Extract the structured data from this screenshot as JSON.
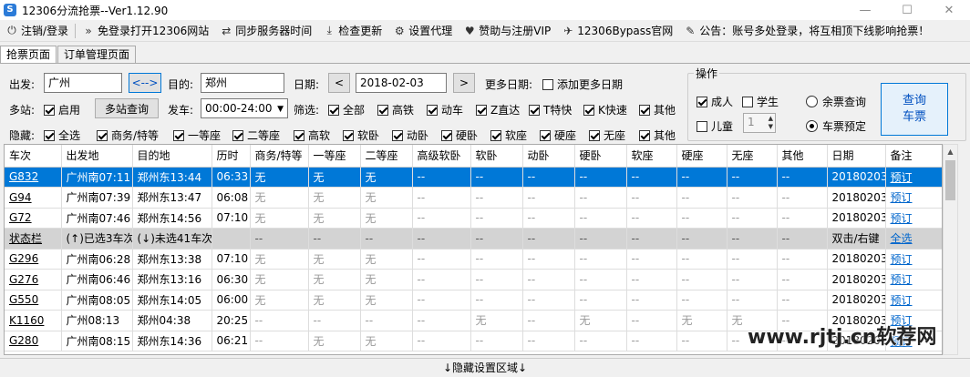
{
  "window": {
    "title": "12306分流抢票--Ver1.12.90",
    "icon": "S"
  },
  "menu": [
    {
      "icon": "⏻",
      "label": "注销/登录"
    },
    {
      "icon": "»",
      "label": "免登录打开12306网站"
    },
    {
      "icon": "⇄",
      "label": "同步服务器时间"
    },
    {
      "icon": "⤓",
      "label": "检查更新"
    },
    {
      "icon": "⚙",
      "label": "设置代理"
    },
    {
      "icon": "♥",
      "label": "赞助与注册VIP"
    },
    {
      "icon": "✈",
      "label": "12306Bypass官网"
    },
    {
      "icon": "✎",
      "label": "公告：账号多处登录，将互相顶下线影响抢票！"
    }
  ],
  "tabs": [
    "抢票页面",
    "订单管理页面"
  ],
  "form": {
    "from_label": "出发:",
    "from_value": "广州",
    "swap_label": "<-->",
    "to_label": "目的:",
    "to_value": "郑州",
    "date_label": "日期:",
    "date_prev": "<",
    "date_value": "2018-02-03",
    "date_next": ">",
    "more_dates_label": "更多日期:",
    "add_more_dates": "添加更多日期",
    "multi_station_label": "多站:",
    "enable": "启用",
    "multi_query_btn": "多站查询",
    "depart_label": "发车:",
    "depart_value": "00:00-24:00",
    "filter_label": "筛选:",
    "filter_options": [
      "全部",
      "高铁",
      "动车",
      "Z直达",
      "T特快",
      "K快速",
      "其他"
    ],
    "hide_label": "隐藏:",
    "hide_options": [
      "全选",
      "商务/特等",
      "一等座",
      "二等座",
      "高软",
      "软卧",
      "动卧",
      "硬卧",
      "软座",
      "硬座",
      "无座",
      "其他"
    ]
  },
  "operations": {
    "title": "操作",
    "adult": "成人",
    "student": "学生",
    "child": "儿童",
    "child_count": "1",
    "remaining_query": "余票查询",
    "ticket_booking": "车票预定",
    "query_btn_line1": "查询",
    "query_btn_line2": "车票"
  },
  "table": {
    "headers": [
      "车次",
      "出发地",
      "目的地",
      "历时",
      "商务/特等",
      "一等座",
      "二等座",
      "高级软卧",
      "软卧",
      "动卧",
      "硬卧",
      "软座",
      "硬座",
      "无座",
      "其他",
      "日期",
      "备注"
    ],
    "rows": [
      {
        "type": "sel",
        "cells": [
          "G832",
          "广州南07:11",
          "郑州东13:44",
          "06:33",
          "无",
          "无",
          "无",
          "--",
          "--",
          "--",
          "--",
          "--",
          "--",
          "--",
          "--",
          "20180203",
          "预订"
        ]
      },
      {
        "type": "normal",
        "cells": [
          "G94",
          "广州南07:39",
          "郑州东13:47",
          "06:08",
          "无",
          "无",
          "无",
          "--",
          "--",
          "--",
          "--",
          "--",
          "--",
          "--",
          "--",
          "20180203",
          "预订"
        ]
      },
      {
        "type": "normal",
        "cells": [
          "G72",
          "广州南07:46",
          "郑州东14:56",
          "07:10",
          "无",
          "无",
          "无",
          "--",
          "--",
          "--",
          "--",
          "--",
          "--",
          "--",
          "--",
          "20180203",
          "预订"
        ]
      },
      {
        "type": "status",
        "cells": [
          "状态栏",
          "(↑)已选3车次",
          "(↓)未选41车次",
          "",
          "--",
          "--",
          "--",
          "--",
          "--",
          "--",
          "--",
          "--",
          "--",
          "--",
          "--",
          "双击/右键",
          "全选"
        ]
      },
      {
        "type": "normal",
        "cells": [
          "G296",
          "广州南06:28",
          "郑州东13:38",
          "07:10",
          "无",
          "无",
          "无",
          "--",
          "--",
          "--",
          "--",
          "--",
          "--",
          "--",
          "--",
          "20180203",
          "预订"
        ]
      },
      {
        "type": "normal",
        "cells": [
          "G276",
          "广州南06:46",
          "郑州东13:16",
          "06:30",
          "无",
          "无",
          "无",
          "--",
          "--",
          "--",
          "--",
          "--",
          "--",
          "--",
          "--",
          "20180203",
          "预订"
        ]
      },
      {
        "type": "normal",
        "cells": [
          "G550",
          "广州南08:05",
          "郑州东14:05",
          "06:00",
          "无",
          "无",
          "无",
          "--",
          "--",
          "--",
          "--",
          "--",
          "--",
          "--",
          "--",
          "20180203",
          "预订"
        ]
      },
      {
        "type": "normal",
        "cells": [
          "K1160",
          "广州08:13",
          "郑州04:38",
          "20:25",
          "--",
          "--",
          "--",
          "--",
          "无",
          "--",
          "无",
          "--",
          "无",
          "无",
          "--",
          "20180203",
          "预订"
        ]
      },
      {
        "type": "normal",
        "cells": [
          "G280",
          "广州南08:15",
          "郑州东14:36",
          "06:21",
          "--",
          "无",
          "无",
          "--",
          "--",
          "--",
          "--",
          "--",
          "--",
          "--",
          "--",
          "20180203",
          "预订"
        ]
      }
    ]
  },
  "bottom_bar": "↓隐藏设置区域↓",
  "watermark": "www.rjtj.cn软荐网"
}
